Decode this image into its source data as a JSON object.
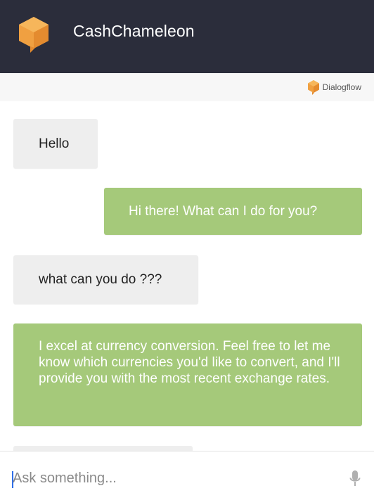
{
  "app": {
    "title": "CashChameleon",
    "brand_label": "Dialogflow"
  },
  "colors": {
    "header": "#2b2d3b",
    "accent_orange": "#f29d38",
    "bot_bubble": "#a5c97a",
    "user_bubble": "#eeeeee"
  },
  "messages": [
    {
      "sender": "user",
      "text": "Hello"
    },
    {
      "sender": "bot",
      "text": "Hi there! What can I do for you?"
    },
    {
      "sender": "user",
      "text": "what can you do ???"
    },
    {
      "sender": "bot",
      "text": "I excel at currency conversion. Feel free to let me know which currencies you'd like to convert, and I'll provide you with the most recent exchange rates."
    }
  ],
  "composer": {
    "placeholder": "Ask something...",
    "value": "",
    "mic_icon": "microphone-icon"
  }
}
